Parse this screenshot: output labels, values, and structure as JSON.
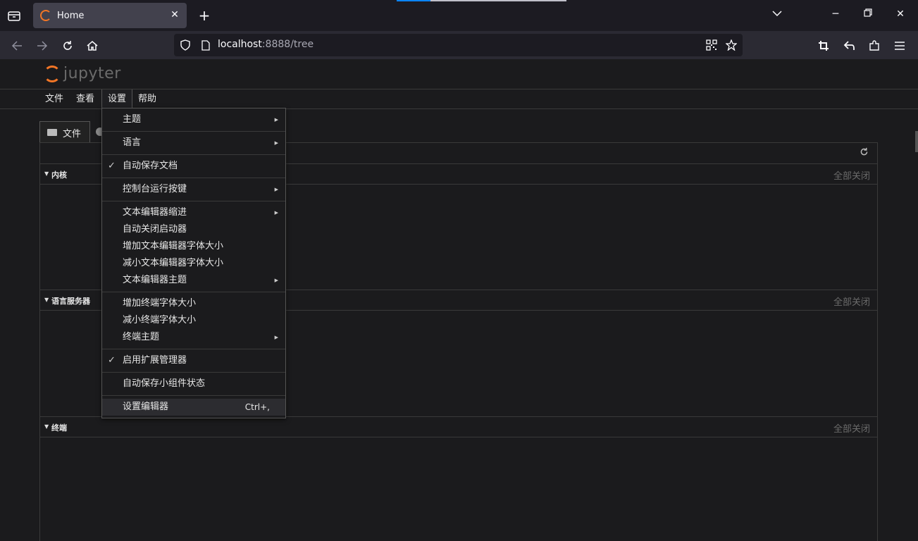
{
  "browser": {
    "tab_title": "Home",
    "url_host": "localhost",
    "url_rest": ":8888/tree"
  },
  "jupyter": {
    "logo_text": "jupyter",
    "menu": [
      "文件",
      "查看",
      "设置",
      "帮助"
    ],
    "panel_tab": "文件",
    "sections": [
      {
        "label": "内核",
        "action": "全部关闭"
      },
      {
        "label": "语言服务器",
        "action": "全部关闭"
      },
      {
        "label": "终端",
        "action": "全部关闭"
      }
    ]
  },
  "settings_menu": {
    "items": [
      {
        "label": "主题",
        "submenu": true,
        "checked": false
      },
      {
        "label": "语言",
        "submenu": true,
        "checked": false
      },
      {
        "label": "自动保存文档",
        "submenu": false,
        "checked": true
      },
      {
        "label": "控制台运行按键",
        "submenu": true,
        "checked": false
      },
      {
        "label": "文本编辑器缩进",
        "submenu": true,
        "checked": false
      },
      {
        "label": "自动关闭启动器",
        "submenu": false,
        "checked": false
      },
      {
        "label": "增加文本编辑器字体大小",
        "submenu": false,
        "checked": false
      },
      {
        "label": "减小文本编辑器字体大小",
        "submenu": false,
        "checked": false
      },
      {
        "label": "文本编辑器主题",
        "submenu": true,
        "checked": false
      },
      {
        "label": "增加终端字体大小",
        "submenu": false,
        "checked": false
      },
      {
        "label": "减小终端字体大小",
        "submenu": false,
        "checked": false
      },
      {
        "label": "终端主题",
        "submenu": true,
        "checked": false
      },
      {
        "label": "启用扩展管理器",
        "submenu": false,
        "checked": true
      },
      {
        "label": "自动保存小组件状态",
        "submenu": false,
        "checked": false
      },
      {
        "label": "设置编辑器",
        "submenu": false,
        "checked": false,
        "shortcut": "Ctrl+,",
        "highlighted": true
      }
    ]
  }
}
